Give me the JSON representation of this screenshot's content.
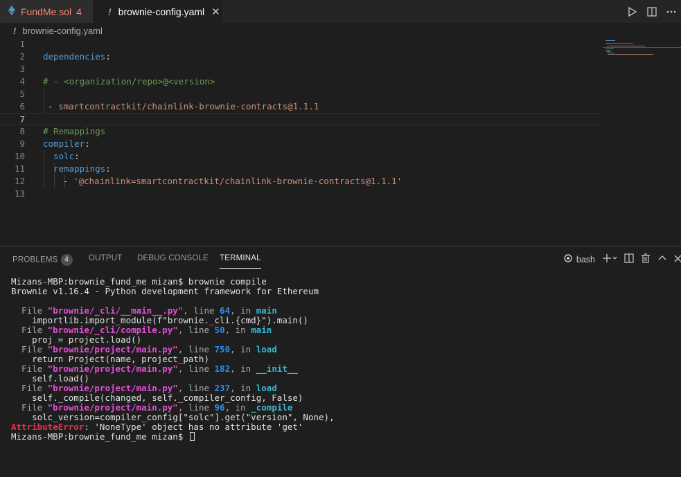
{
  "tabs": [
    {
      "name": "FundMe.sol",
      "problems": "4"
    },
    {
      "name": "brownie-config.yaml",
      "close": "✕"
    }
  ],
  "breadcrumb": {
    "file": "brownie-config.yaml"
  },
  "editor": {
    "line_numbers": [
      "1",
      "2",
      "3",
      "4",
      "5",
      "6",
      "7",
      "8",
      "9",
      "10",
      "11",
      "12",
      "13"
    ],
    "lines": {
      "l2_key": "dependencies",
      "l2_colon": ":",
      "l4_comment": "# - <organization/repo>@<version>",
      "l6_dash": "- ",
      "l6_value": "smartcontractkit/chainlink-brownie-contracts@1.1.1",
      "l8_comment": "# Remappings",
      "l9_key": "compiler",
      "l9_colon": ":",
      "l10_key": "solc",
      "l10_colon": ":",
      "l11_key": "remappings",
      "l11_colon": ":",
      "l12_dash": "- ",
      "l12_value": "'@chainlink=smartcontractkit/chainlink-brownie-contracts@1.1.1'"
    }
  },
  "panel": {
    "tabs": [
      "PROBLEMS",
      "OUTPUT",
      "DEBUG CONSOLE",
      "TERMINAL"
    ],
    "problems_count": "4",
    "shell": "bash"
  },
  "terminal": {
    "prompt_cmd": "Mizans-MBP:brownie_fund_me mizan$ brownie compile",
    "banner": "Brownie v1.16.4 - Python development framework for Ethereum",
    "tb": [
      {
        "path": "\"brownie/_cli/__main__.py\"",
        "line": "64",
        "fn": "main",
        "code": "    importlib.import_module(f\"brownie._cli.{cmd}\").main()"
      },
      {
        "path": "\"brownie/_cli/compile.py\"",
        "line": "50",
        "fn": "main",
        "code": "    proj = project.load()"
      },
      {
        "path": "\"brownie/project/main.py\"",
        "line": "750",
        "fn": "load",
        "code": "    return Project(name, project_path)"
      },
      {
        "path": "\"brownie/project/main.py\"",
        "line": "182",
        "fn": "__init__",
        "code": "    self.load()"
      },
      {
        "path": "\"brownie/project/main.py\"",
        "line": "237",
        "fn": "load",
        "code": "    self._compile(changed, self._compiler_config, False)"
      },
      {
        "path": "\"brownie/project/main.py\"",
        "line": "96",
        "fn": "_compile",
        "code": "    solc_version=compiler_config[\"solc\"].get(\"version\", None),"
      }
    ],
    "file_kw": "  File ",
    "line_kw": ", line ",
    "in_kw": ", in ",
    "error_name": "AttributeError",
    "error_msg": ": 'NoneType' object has no attribute 'get'",
    "final_prompt": "Mizans-MBP:brownie_fund_me mizan$ "
  }
}
